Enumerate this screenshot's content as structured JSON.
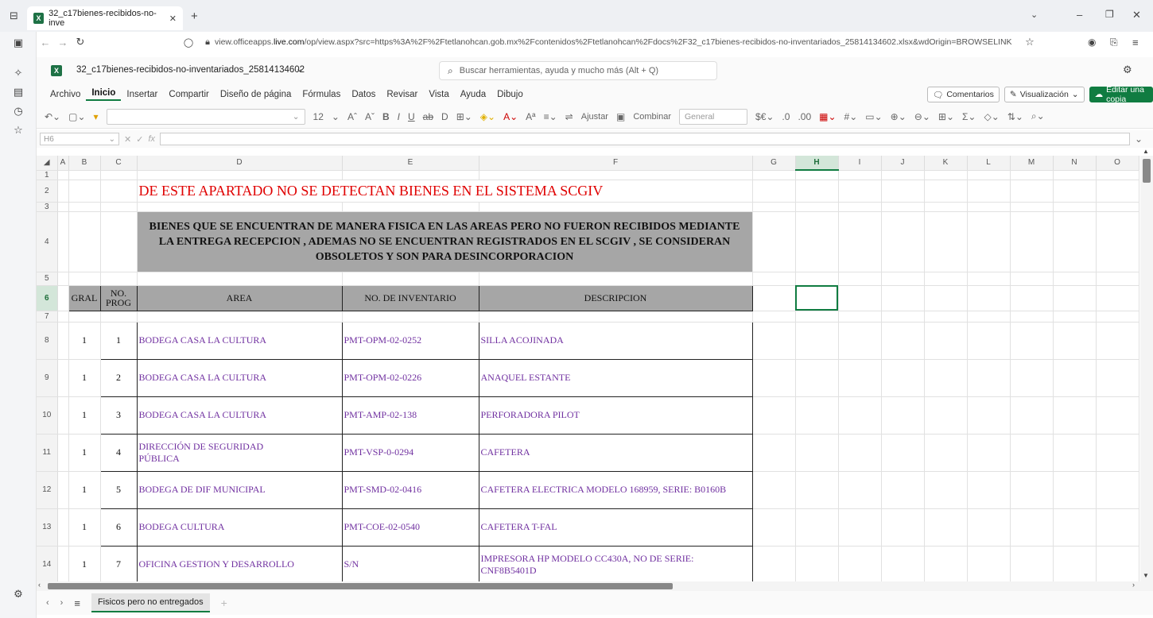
{
  "browser": {
    "tab_title": "32_c17bienes-recibidos-no-inve",
    "url_prefix": "view.officeapps.",
    "url_domain": "live.com",
    "url_rest": "/op/view.aspx?src=https%3A%2F%2Ftetlanohcan.gob.mx%2Fcontenidos%2Ftetlanohcan%2Fdocs%2F32_c17bienes-recibidos-no-inventariados_25814134602.xlsx&wdOrigin=BROWSELINK"
  },
  "app": {
    "filename": "32_c17bienes-recibidos-no-inventariados_25814134602",
    "search_placeholder": "Buscar herramientas, ayuda y mucho más (Alt + Q)",
    "menu": [
      "Archivo",
      "Inicio",
      "Insertar",
      "Compartir",
      "Diseño de página",
      "Fórmulas",
      "Datos",
      "Revisar",
      "Vista",
      "Ayuda",
      "Dibujo"
    ],
    "comments_label": "Comentarios",
    "view_label": "Visualización",
    "edit_copy_label": "Editar una copia"
  },
  "toolbar": {
    "font_size": "12",
    "wrap_label": "Ajustar",
    "merge_label": "Combinar",
    "number_format": "General"
  },
  "formula_bar": {
    "cell_ref": "H6",
    "fx": "fx"
  },
  "sheet": {
    "columns": [
      "A",
      "B",
      "C",
      "D",
      "E",
      "F",
      "G",
      "H",
      "I",
      "J",
      "K",
      "L",
      "M",
      "N",
      "O"
    ],
    "selected_col": "H",
    "notice": "DE ESTE APARTADO NO SE DETECTAN BIENES EN EL SISTEMA SCGIV",
    "banner": "BIENES QUE SE ENCUENTRAN DE MANERA FISICA EN LAS AREAS PERO NO FUERON RECIBIDOS MEDIANTE  LA ENTREGA RECEPCION , ADEMAS NO SE ENCUENTRAN REGISTRADOS EN EL SCGIV , SE CONSIDERAN OBSOLETOS  Y SON PARA DESINCORPORACION",
    "headers": {
      "gral": "GRAL",
      "prog": "NO. PROG",
      "area": "AREA",
      "inventario": "NO. DE INVENTARIO",
      "descripcion": "DESCRIPCION"
    },
    "rows": [
      {
        "row": "8",
        "gral": "1",
        "prog": "1",
        "area": "BODEGA   CASA LA CULTURA",
        "inv": "PMT-OPM-02-0252",
        "desc": "SILLA ACOJINADA"
      },
      {
        "row": "9",
        "gral": "1",
        "prog": "2",
        "area": "BODEGA   CASA LA CULTURA",
        "inv": "PMT-OPM-02-0226",
        "desc": "ANAQUEL ESTANTE"
      },
      {
        "row": "10",
        "gral": "1",
        "prog": "3",
        "area": "BODEGA   CASA LA CULTURA",
        "inv": "PMT-AMP-02-138",
        "desc": "PERFORADORA PILOT"
      },
      {
        "row": "11",
        "gral": "1",
        "prog": "4",
        "area": "DIRECCIÓN DE SEGURIDAD PÚBLICA",
        "inv": "PMT-VSP-0-0294",
        "desc": "CAFETERA"
      },
      {
        "row": "12",
        "gral": "1",
        "prog": "5",
        "area": "BODEGA DE DIF MUNICIPAL",
        "inv": "PMT-SMD-02-0416",
        "desc": "CAFETERA ELECTRICA MODELO 168959, SERIE: B0160B"
      },
      {
        "row": "13",
        "gral": "1",
        "prog": "6",
        "area": "BODEGA CULTURA",
        "inv": "PMT-COE-02-0540",
        "desc": "CAFETERA T-FAL"
      },
      {
        "row": "14",
        "gral": "1",
        "prog": "7",
        "area": "OFICINA GESTION Y DESARROLLO",
        "inv": "S/N",
        "desc": "IMPRESORA  HP   MODELO CC430A, NO DE SERIE: CNF8B5401D"
      }
    ],
    "tab_name": "Fisicos pero no entregados"
  },
  "colors": {
    "accent": "#107c41",
    "data_text": "#7030a0",
    "notice": "#e00000",
    "banner_bg": "#a6a6a6"
  }
}
